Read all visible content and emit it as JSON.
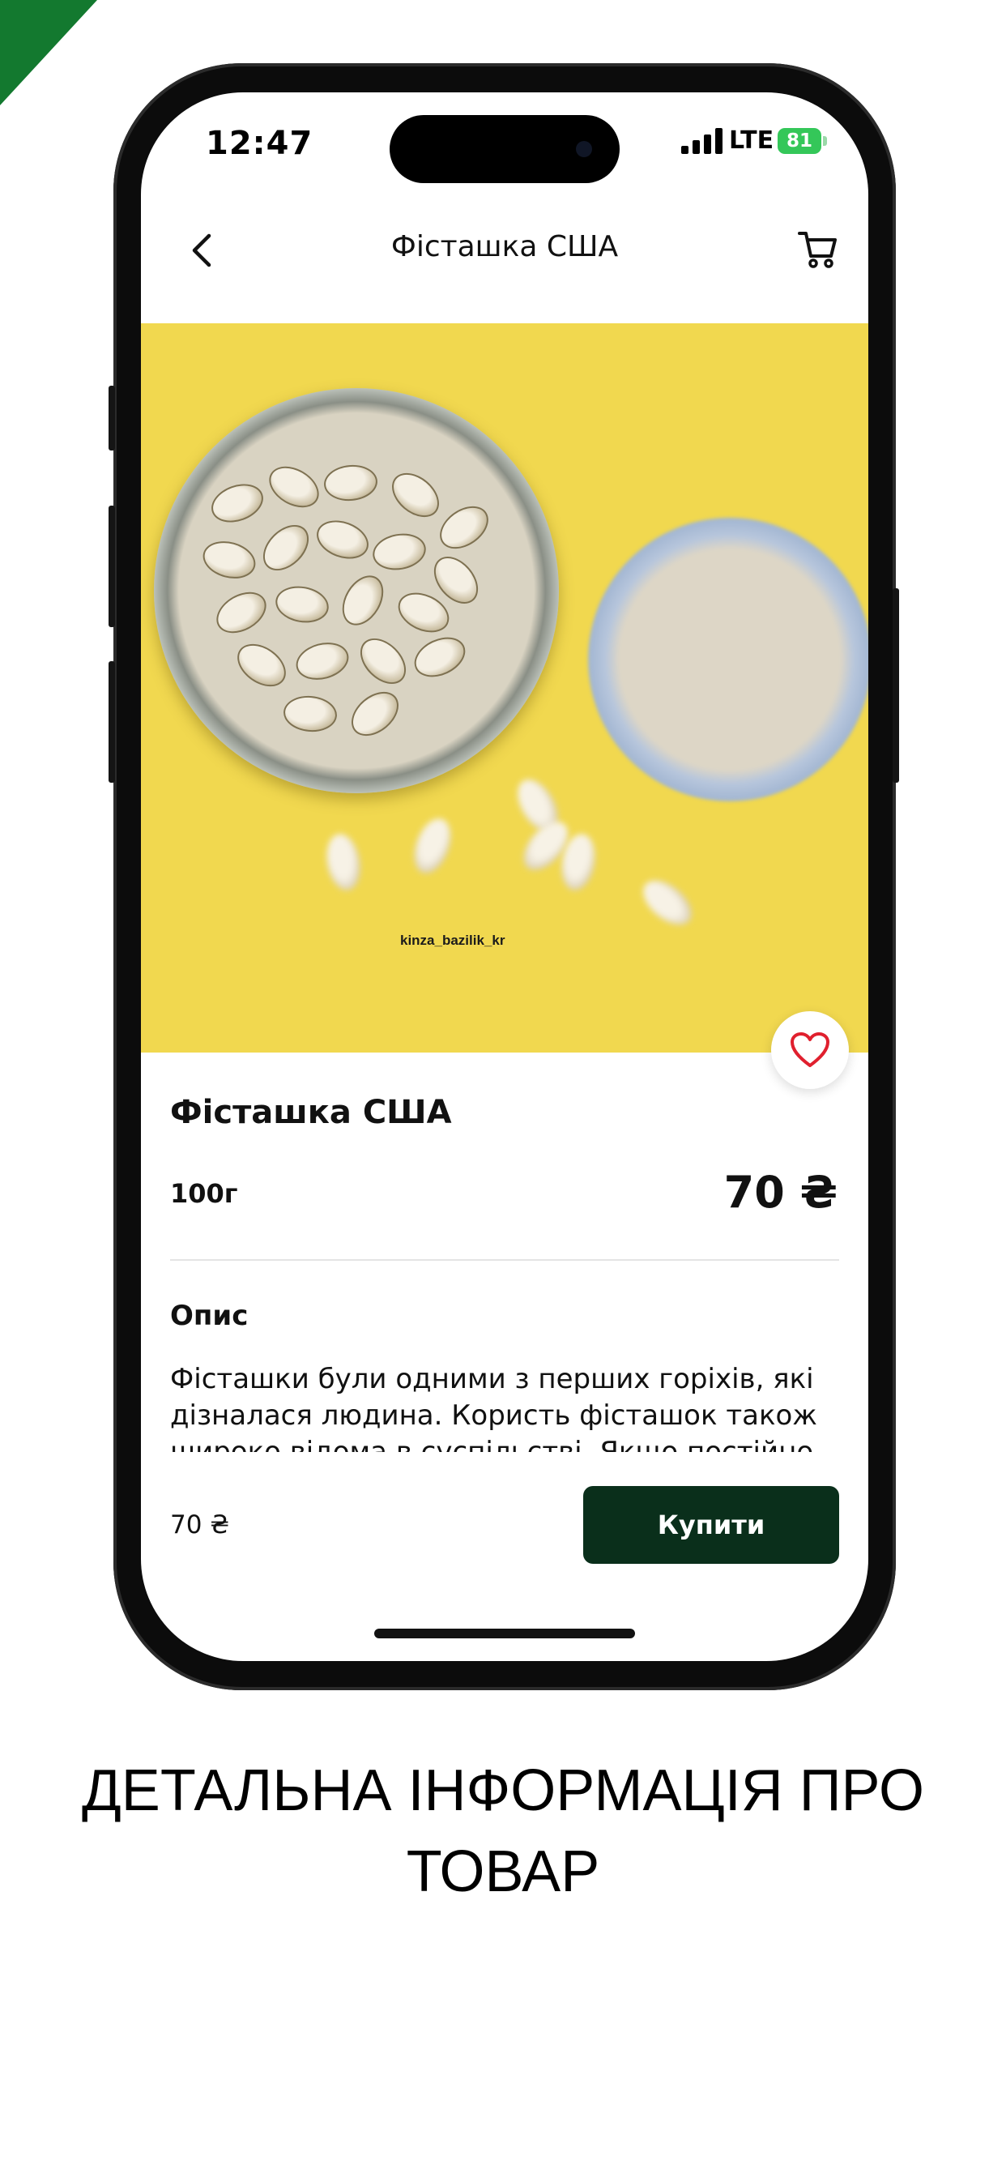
{
  "status_bar": {
    "time": "12:47",
    "network": "LTE",
    "battery": "81"
  },
  "nav": {
    "title": "Фісташка США",
    "back_icon": "chevron-left-icon",
    "cart_icon": "cart-icon"
  },
  "hero": {
    "watermark": "kinza_bazilik_kr",
    "favorite_icon": "heart-icon"
  },
  "product": {
    "title": "Фісташка США",
    "weight": "100г",
    "price": "70 ₴",
    "description_heading": "Опис",
    "description": "Фісташки були одними з перших горіхів, які дізналася людина. Користь фісташок також широко відома в суспільстві. Якщо постійно"
  },
  "footer": {
    "price": "70 ₴",
    "buy_label": "Купити"
  },
  "caption": {
    "line1": "ДЕТАЛЬНА ІНФОРМАЦІЯ ПРО",
    "line2": "ТОВАР"
  },
  "colors": {
    "accent": "#13792f",
    "buy_button": "#0a2f1b",
    "heart": "#e0202e",
    "hero_bg": "#f1d84f",
    "battery": "#34c759"
  }
}
